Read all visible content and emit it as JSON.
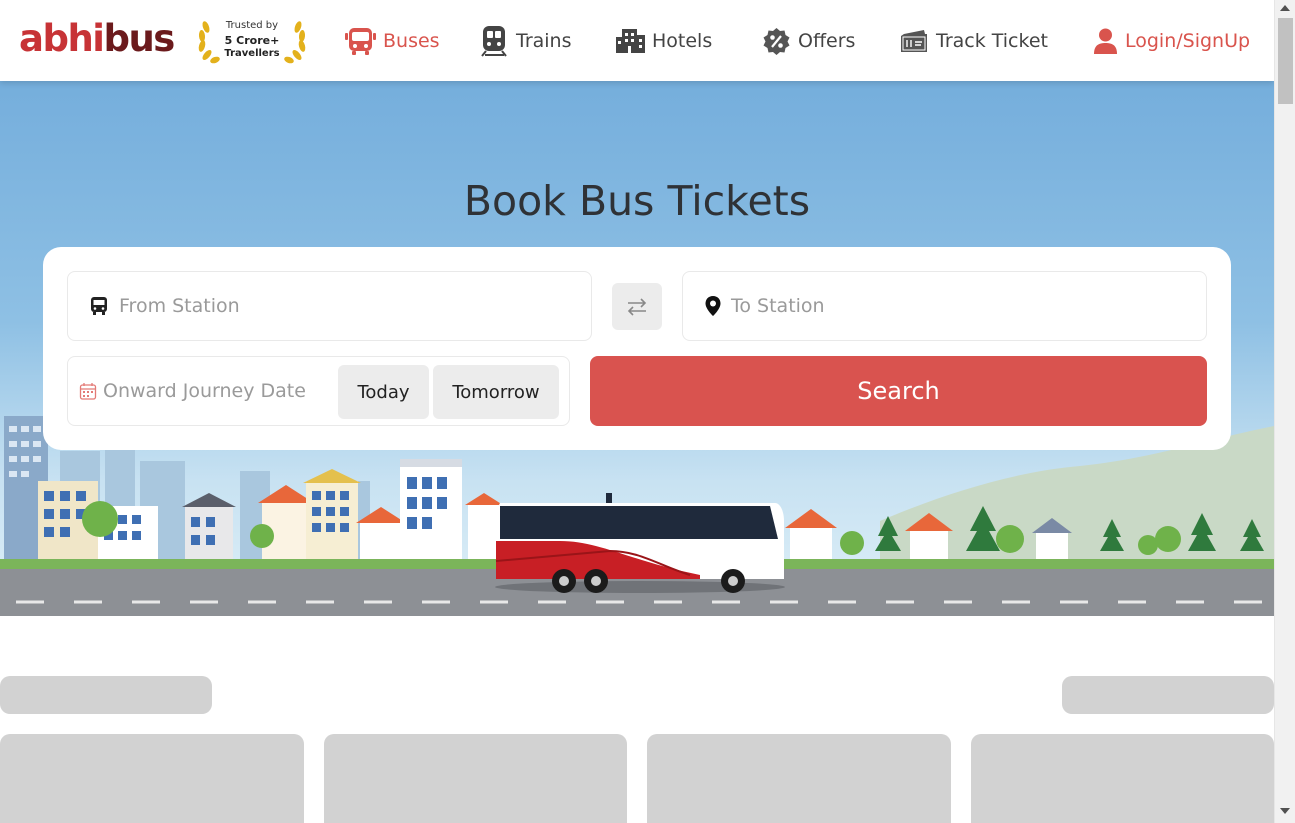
{
  "brand": {
    "logo_part1": "abhi",
    "logo_part2": "bus",
    "trusted_line1": "Trusted by",
    "trusted_line2": "5 Crore+",
    "trusted_line3": "Travellers"
  },
  "nav": {
    "buses": "Buses",
    "trains": "Trains",
    "hotels": "Hotels",
    "offers": "Offers",
    "track": "Track Ticket",
    "login": "Login/SignUp"
  },
  "hero": {
    "title": "Book Bus Tickets"
  },
  "search": {
    "from_placeholder": "From Station",
    "to_placeholder": "To Station",
    "date_placeholder": "Onward Journey Date",
    "today": "Today",
    "tomorrow": "Tomorrow",
    "search_label": "Search"
  },
  "colors": {
    "accent": "#d9534f",
    "logo_red": "#c73336",
    "logo_dark": "#6b1a1c",
    "skeleton": "#d2d2d2"
  }
}
